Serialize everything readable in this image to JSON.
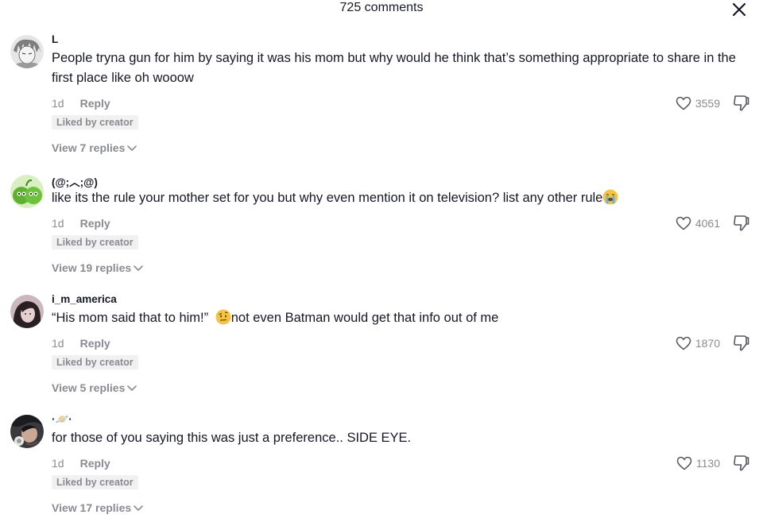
{
  "header": {
    "title": "725 comments",
    "close_icon": "close-icon"
  },
  "comments": [
    {
      "username": "L",
      "text": "People tryna gun for him by saying it was his mom but why would he think that’s something appropriate to share in the first place like oh wooow",
      "time": "1d",
      "reply_label": "Reply",
      "badge": "Liked by creator",
      "likes": "3559",
      "view_replies": "View 7 replies",
      "avatar": "manga-avatar"
    },
    {
      "username": "(@;︿;@)",
      "text": "like its the rule your mother set for you but why even mention it on television? list any other rule",
      "text_emoji": "loudly-crying-face-emoji",
      "time": "1d",
      "reply_label": "Reply",
      "badge": "Liked by creator",
      "likes": "4061",
      "view_replies": "View 19 replies",
      "avatar": "green-peas-avatar"
    },
    {
      "username": "i_m_america",
      "text_before": "“His mom said that to him!” ",
      "text_emoji": "raised-eyebrow-face-emoji",
      "text_after": "not even Batman would get that info out of me",
      "time": "1d",
      "reply_label": "Reply",
      "badge": "Liked by creator",
      "likes": "1870",
      "view_replies": "View 5 replies",
      "avatar": "dark-hair-avatar"
    },
    {
      "username": "·🪐·",
      "text": "for those of you saying this was just a preference.. SIDE EYE.",
      "time": "1d",
      "reply_label": "Reply",
      "badge": "Liked by creator",
      "likes": "1130",
      "view_replies": "View 17 replies",
      "avatar": "dark-portrait-avatar"
    }
  ],
  "icons": {
    "like": "heart-outline-icon",
    "dislike": "thumbs-down-icon",
    "chevron": "chevron-down-icon"
  }
}
